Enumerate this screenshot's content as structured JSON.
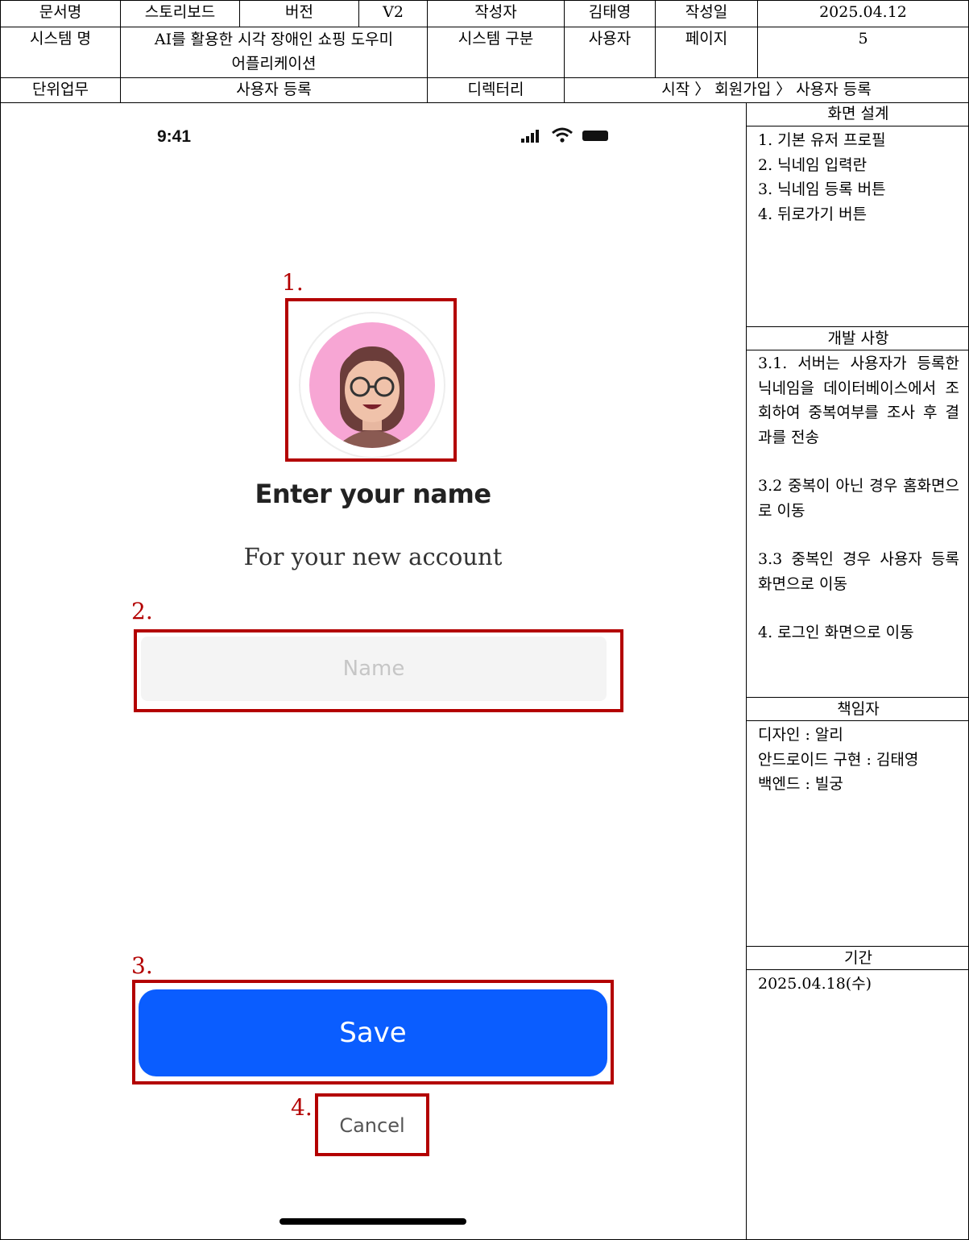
{
  "header": {
    "doc_name_label": "문서명",
    "doc_name_value": "스토리보드",
    "version_label": "버전",
    "version_value": "V2",
    "author_label": "작성자",
    "author_value": "김태영",
    "date_label": "작성일",
    "date_value": "2025.04.12",
    "system_name_label": "시스템 명",
    "system_name_value_line1": "AI를 활용한 시각 장애인 쇼핑 도우미",
    "system_name_value_line2": "어플리케이션",
    "system_type_label": "시스템 구분",
    "system_type_value": "사용자",
    "page_label": "페이지",
    "page_value": "5",
    "unit_task_label": "단위업무",
    "unit_task_value": "사용자 등록",
    "directory_label": "디렉터리",
    "directory_value": "시작 〉 회원가입 〉 사용자 등록"
  },
  "phone": {
    "status_time": "9:41",
    "heading": "Enter your name",
    "subheading": "For your new account",
    "name_placeholder": "Name",
    "save_label": "Save",
    "cancel_label": "Cancel",
    "markers": [
      "1.",
      "2.",
      "3.",
      "4."
    ]
  },
  "design": {
    "title": "화면 설계",
    "items": [
      "1. 기본 유저 프로필",
      "2. 닉네임 입력란",
      "3. 닉네임 등록 버튼",
      "4. 뒤로가기 버튼"
    ]
  },
  "development": {
    "title": "개발 사항",
    "item1": "3.1. 서버는 사용자가 등록한 닉네임을 데이터베이스에서 조회하여 중복여부를 조사 후 결과를 전송",
    "item2": "3.2 중복이 아닌 경우 홈화면으로 이동",
    "item3": "3.3 중복인 경우 사용자 등록 화면으로 이동",
    "item4": "4. 로그인 화면으로 이동"
  },
  "owner": {
    "title": "책임자",
    "items": [
      "디자인 : 알리",
      "안드로이드 구현 : 김태영",
      "백엔드 : 빌궁"
    ]
  },
  "period": {
    "title": "기간",
    "value": "2025.04.18(수)"
  },
  "colors": {
    "annotation_red": "#b30000",
    "save_blue": "#0a5dff",
    "avatar_pink": "#f7a6d4"
  }
}
